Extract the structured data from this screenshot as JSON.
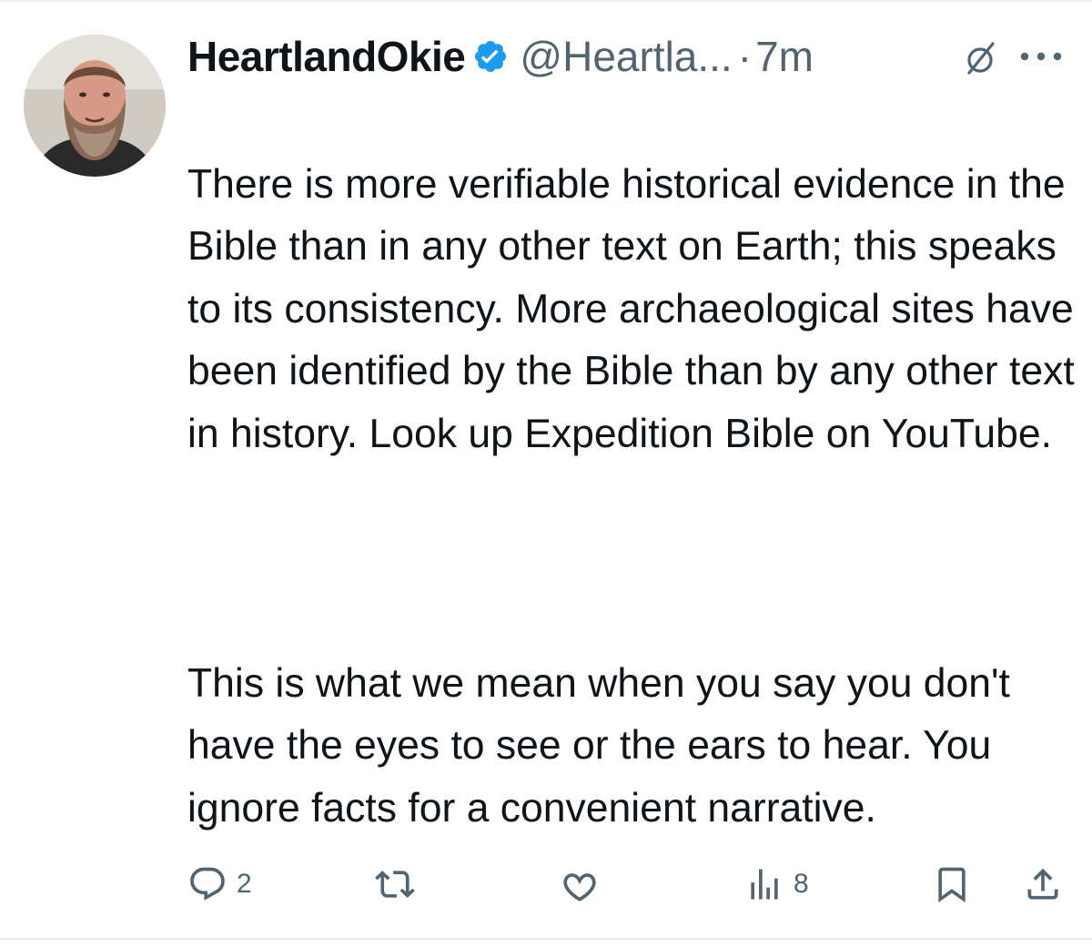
{
  "tweet": {
    "author": {
      "display_name": "HeartlandOkie",
      "handle": "@Heartla...",
      "verified": true,
      "avatar_icon": "user-avatar-photo"
    },
    "separator": "·",
    "time": "7m",
    "paragraphs": [
      "There is more verifiable historical evidence in the Bible than in any other text on Earth; this speaks to its consistency. More archaeological sites have been identified by the Bible than by any other text in history. Look up Expedition Bible on YouTube.",
      "This is what we mean when you say you don't have the eyes to see or the ears to hear. You ignore facts for a convenient narrative."
    ],
    "actions": {
      "reply": {
        "icon": "reply-icon",
        "count": "2"
      },
      "retweet": {
        "icon": "retweet-icon",
        "count": ""
      },
      "like": {
        "icon": "like-icon",
        "count": ""
      },
      "views": {
        "icon": "views-icon",
        "count": "8"
      },
      "bookmark": {
        "icon": "bookmark-icon"
      },
      "share": {
        "icon": "share-icon"
      }
    }
  },
  "colors": {
    "text_primary": "#0f1419",
    "text_secondary": "#536471",
    "verified_blue": "#1d9bf0",
    "divider": "#eff3f4"
  }
}
